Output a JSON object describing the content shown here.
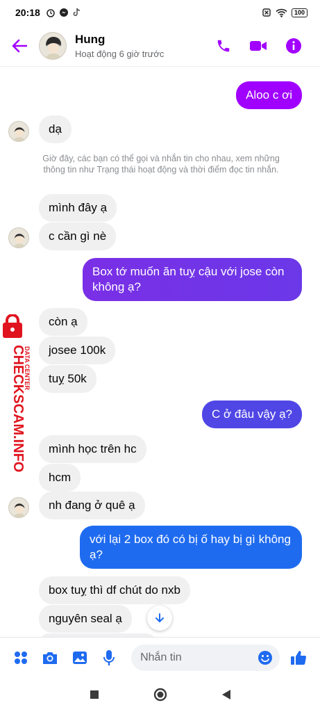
{
  "status_bar": {
    "time": "20:18",
    "battery": "100"
  },
  "header": {
    "name": "Hung",
    "status": "Hoạt động 6 giờ trước"
  },
  "notice": "Giờ đây, các bạn có thể gọi và nhắn tin cho nhau, xem những thông tin như Trạng thái hoạt động và thời điểm đọc tin nhắn.",
  "messages": [
    {
      "from": "me",
      "text": "Aloo c ơi"
    },
    {
      "from": "them",
      "text": "dạ"
    },
    {
      "from": "them",
      "text": "mình đây ạ"
    },
    {
      "from": "them",
      "text": "c cần gì nè"
    },
    {
      "from": "me",
      "text": "Box tớ muốn ăn tuỵ cậu với jose còn không ạ?"
    },
    {
      "from": "them",
      "text": "còn ạ"
    },
    {
      "from": "them",
      "text": "josee 100k"
    },
    {
      "from": "them",
      "text": "tuỵ 50k"
    },
    {
      "from": "me",
      "text": "C ở đâu vậy ạ?"
    },
    {
      "from": "them",
      "text": "mình học trên hc"
    },
    {
      "from": "them",
      "text": "hcm"
    },
    {
      "from": "them",
      "text": "nh đang ở quê ạ"
    },
    {
      "from": "me",
      "text": "với lại 2 box đó có bị ố hay bị gì không ạ?"
    },
    {
      "from": "them",
      "text": "box tuỵ thì df chút do nxb"
    },
    {
      "from": "them",
      "text": "nguyên seal ạ"
    }
  ],
  "composer": {
    "placeholder": "Nhắn tin"
  },
  "watermark": {
    "brand": "CHECKSCAM.INFO",
    "tag": "DATA CENTER"
  },
  "colors": {
    "accent": "#a200ff",
    "bubble_purple": "#8e2de2",
    "bubble_blue": "#1f6bf0",
    "incoming": "#f0f0f0"
  }
}
